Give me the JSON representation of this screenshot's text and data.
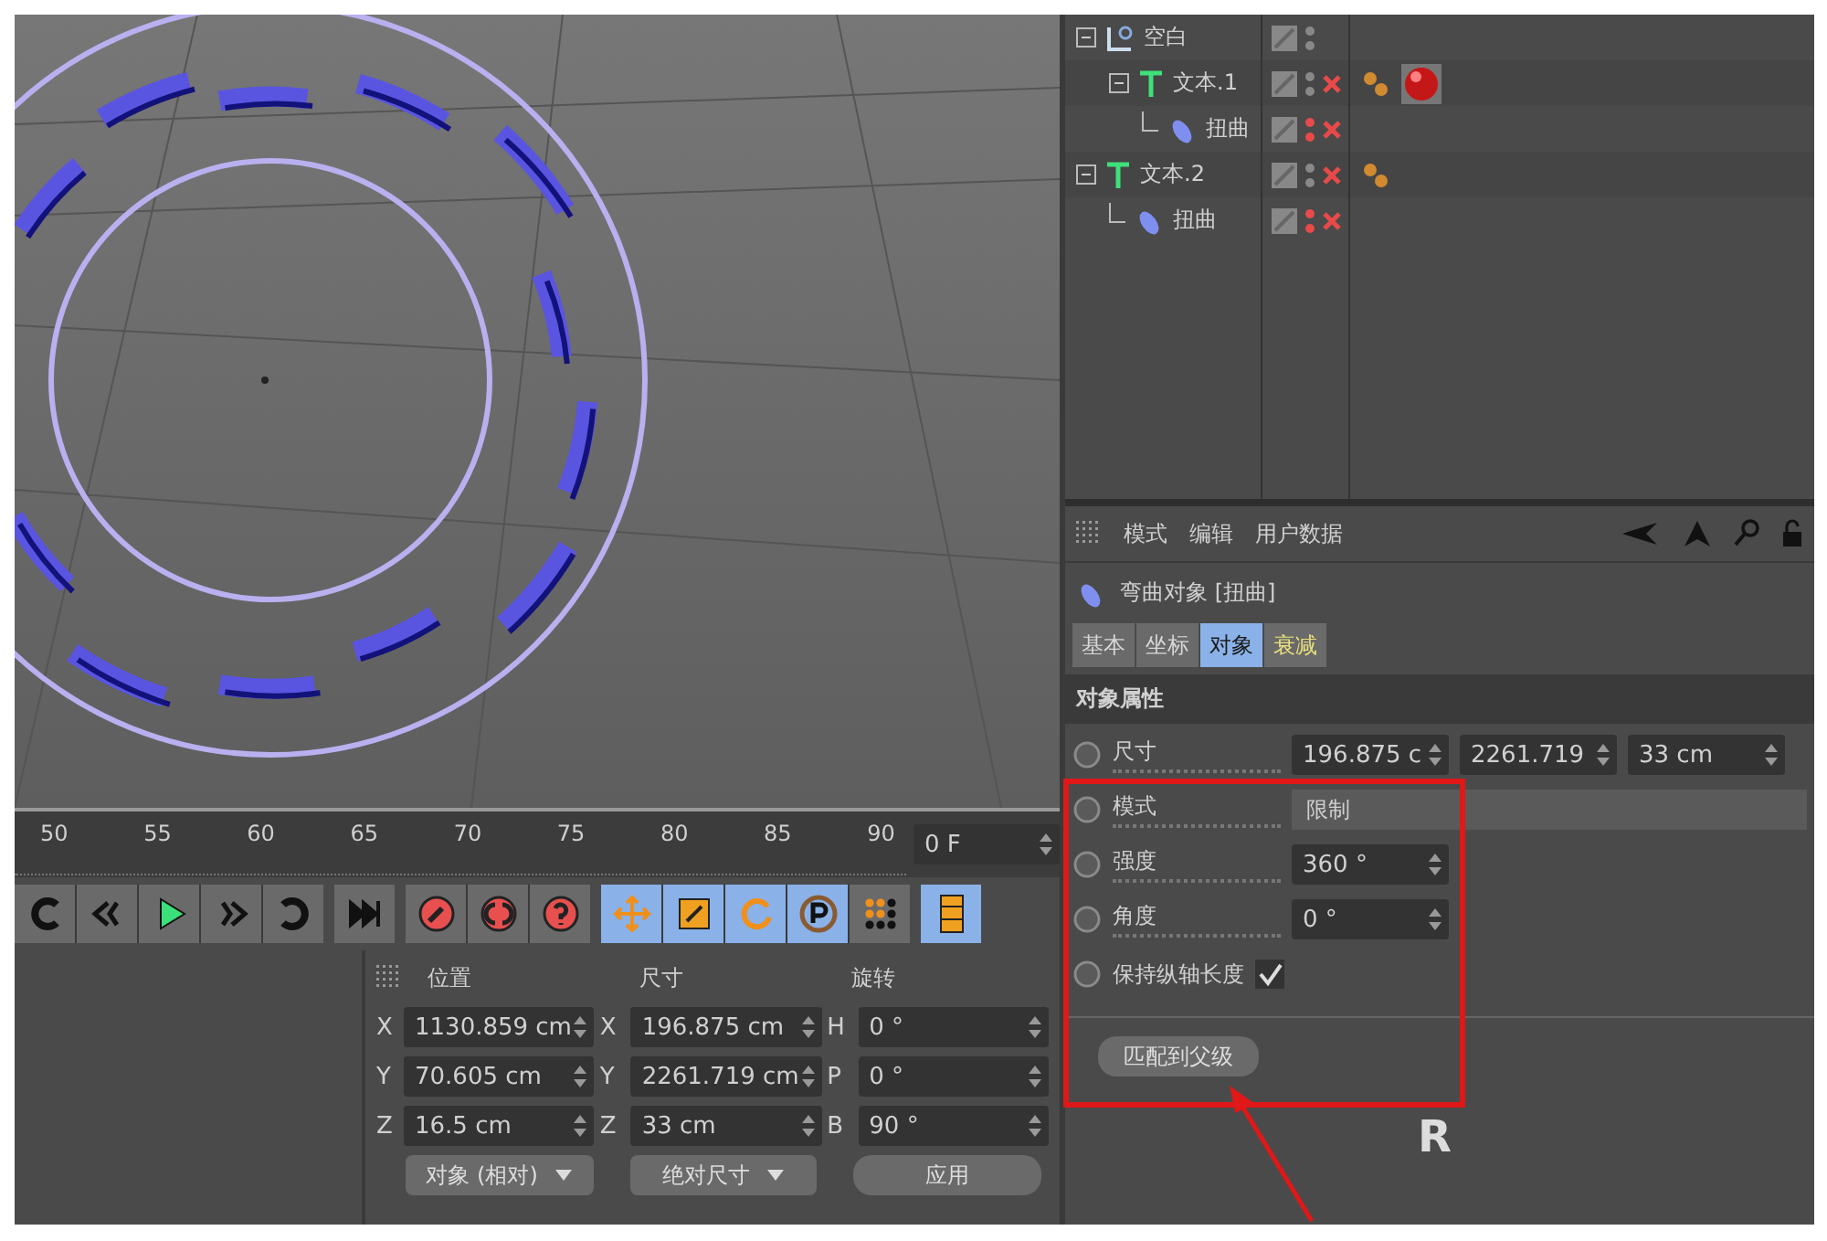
{
  "timeline": {
    "ticks": [
      "50",
      "55",
      "60",
      "65",
      "70",
      "75",
      "80",
      "85",
      "90"
    ],
    "frame": "0 F"
  },
  "toolbar": {
    "tools": [
      {
        "kind": "loop-back",
        "selected": false
      },
      {
        "kind": "prev-key",
        "selected": false
      },
      {
        "kind": "play",
        "selected": false
      },
      {
        "kind": "next-key",
        "selected": false
      },
      {
        "kind": "loop-forward",
        "selected": false
      },
      {
        "kind": "end",
        "selected": false
      },
      {
        "kind": "record",
        "selected": false
      },
      {
        "kind": "autokey",
        "selected": false
      },
      {
        "kind": "help",
        "selected": false
      },
      {
        "kind": "move",
        "selected": true
      },
      {
        "kind": "scale",
        "selected": true
      },
      {
        "kind": "rotate",
        "selected": true
      },
      {
        "kind": "param",
        "selected": true
      },
      {
        "kind": "points",
        "selected": false
      },
      {
        "kind": "film",
        "selected": true
      }
    ]
  },
  "coordinates": {
    "headers": [
      "位置",
      "尺寸",
      "旋转"
    ],
    "rows": [
      {
        "axis": "X",
        "position": "1130.859 cm",
        "size_axis": "X",
        "size": "196.875 cm",
        "rot_axis": "H",
        "rotation": "0 °"
      },
      {
        "axis": "Y",
        "position": "70.605 cm",
        "size_axis": "Y",
        "size": "2261.719 cm",
        "rot_axis": "P",
        "rotation": "0 °"
      },
      {
        "axis": "Z",
        "position": "16.5 cm",
        "size_axis": "Z",
        "size": "33 cm",
        "rot_axis": "B",
        "rotation": "90 °"
      }
    ],
    "mode": "对象 (相对)",
    "size_mode": "绝对尺寸",
    "apply": "应用"
  },
  "object_manager": {
    "objects": [
      {
        "name": "空白",
        "kind": "null",
        "x_mark": false,
        "red_dots": false,
        "expanded": true,
        "children": [
          {
            "name": "文本.1",
            "kind": "text",
            "x_mark": true,
            "red_dots": false,
            "tags": [
              {
                "kind": "phong"
              },
              {
                "kind": "material"
              }
            ],
            "expanded": true,
            "children": [
              {
                "name": "扭曲",
                "kind": "bend",
                "x_mark": true,
                "red_dots": true
              }
            ]
          }
        ]
      },
      {
        "name": "文本.2",
        "kind": "text",
        "x_mark": true,
        "red_dots": false,
        "tags": [
          {
            "kind": "phong"
          }
        ],
        "expanded": true,
        "children": [
          {
            "name": "扭曲",
            "kind": "bend",
            "x_mark": true,
            "red_dots": true
          }
        ]
      }
    ]
  },
  "attributes": {
    "menu": [
      "模式",
      "编辑",
      "用户数据"
    ],
    "title": "弯曲对象 [扭曲]",
    "tabs": [
      {
        "label": "基本",
        "selected": false,
        "kind": "plain"
      },
      {
        "label": "坐标",
        "selected": false,
        "kind": "plain"
      },
      {
        "label": "对象",
        "selected": true,
        "kind": "plain"
      },
      {
        "label": "衰减",
        "selected": false,
        "kind": "falloff"
      }
    ],
    "section": "对象属性",
    "properties": [
      {
        "kind": "vector",
        "label": "尺寸",
        "values": [
          "196.875 c",
          "2261.719",
          "33 cm"
        ]
      },
      {
        "kind": "dropdown",
        "label": "模式",
        "value": "限制"
      },
      {
        "kind": "number",
        "label": "强度",
        "value": "360 °"
      },
      {
        "kind": "number",
        "label": "角度",
        "value": "0 °"
      },
      {
        "kind": "checkbox",
        "label": "保持纵轴长度",
        "checked": true
      }
    ],
    "button": "匹配到父级"
  },
  "overlay_mark": "R"
}
